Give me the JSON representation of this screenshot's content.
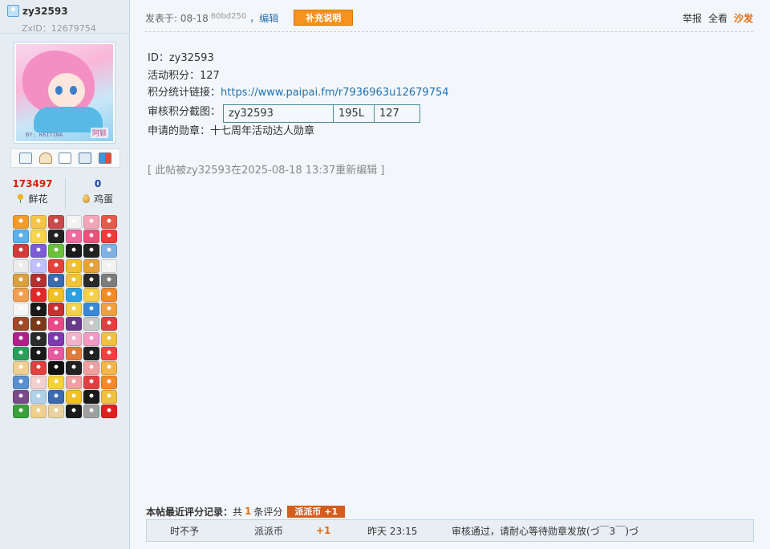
{
  "user": {
    "name": "zy32593",
    "zxid": "ZxID：12679754",
    "avatar": {
      "signature": "BY: KRITINA",
      "tag": "阿颖"
    },
    "tools": [
      "mail-icon",
      "add-friend-icon",
      "search-icon",
      "profile-card-icon",
      "blocks-icon"
    ],
    "stats": {
      "flowers": {
        "value": "173497",
        "label": "鲜花",
        "color": "#d81e06"
      },
      "eggs": {
        "value": "0",
        "label": "鸡蛋",
        "color": "#1a3fa6"
      }
    },
    "medal_colors": [
      "#f39c2c",
      "#f5c542",
      "#c84a4a",
      "#f2f2f2",
      "#f4a6b8",
      "#e55a4a",
      "#5ab0e8",
      "#f7d44a",
      "#222222",
      "#f06aa0",
      "#e8527a",
      "#ef3b3b",
      "#d43a3a",
      "#7b5bd6",
      "#6cbf3a",
      "#1b1b1b",
      "#222222",
      "#7fb3e8",
      "#ececec",
      "#c0c0ff",
      "#e4423a",
      "#f0c030",
      "#e6a23a",
      "#f2f2f2",
      "#d8a040",
      "#b23030",
      "#3a6ab0",
      "#f4c23a",
      "#2a2a2a",
      "#7d7d7d",
      "#f0a050",
      "#e02a2a",
      "#f2c020",
      "#2aa0e0",
      "#f7d04a",
      "#f28a2a",
      "#f5f5f5",
      "#1a1a1a",
      "#c93030",
      "#f2d24a",
      "#3a88d8",
      "#f0a040",
      "#a04a2a",
      "#7a3a1a",
      "#e84a88",
      "#6a3a8a",
      "#c8c8c8",
      "#e04040",
      "#b0208a",
      "#2a2a2a",
      "#7b3ab0",
      "#f4b0c8",
      "#f19ac2",
      "#f2c040",
      "#2aa05a",
      "#1a1a1a",
      "#e85aa0",
      "#e07a3a",
      "#222222",
      "#f04040",
      "#f0d090",
      "#e04040",
      "#111111",
      "#222222",
      "#f0a0a0",
      "#f2b64a",
      "#5a90d0",
      "#f2d0d0",
      "#f7d33a",
      "#f0a0a0",
      "#e04040",
      "#f28a2a",
      "#7a4a8a",
      "#b0d0e8",
      "#3a6ab0",
      "#f2c020",
      "#1a1a1a",
      "#f2c040",
      "#3aa03a",
      "#f0d090",
      "#e8d2a0",
      "#1a1a1a",
      "#a0a0a0",
      "#e02020"
    ]
  },
  "post": {
    "posted": "发表于: 08-18",
    "ip": "60bd250",
    "edit_label": "，编辑",
    "supplement_label": "补充说明",
    "report_label": "举报",
    "view_all_label": "全看",
    "sofa_label": "沙发",
    "lines": {
      "id": "ID：zy32593",
      "points": "活动积分：127",
      "link_label": "积分统计链接：",
      "link_url": "https://www.paipai.fm/r7936963u12679754",
      "screenshot_label": "审核积分截图：",
      "medal": "申请的勋章：十七周年活动达人勋章"
    },
    "screenshot_table": [
      "zy32593",
      "195L",
      "127"
    ],
    "edited_note": "[ 此帖被zy32593在2025-08-18 13:37重新编辑 ]"
  },
  "rating": {
    "title": "本帖最近评分记录：",
    "count_prefix": "共",
    "count": "1",
    "count_suffix": "条评分",
    "badge": "派派币 +1",
    "rows": [
      {
        "user": "时不予",
        "currency": "派派币",
        "amount": "+1",
        "time": "昨天 23:15",
        "reason": "审核通过，请耐心等待勋章发放(づ￣3￣)づ"
      }
    ]
  }
}
